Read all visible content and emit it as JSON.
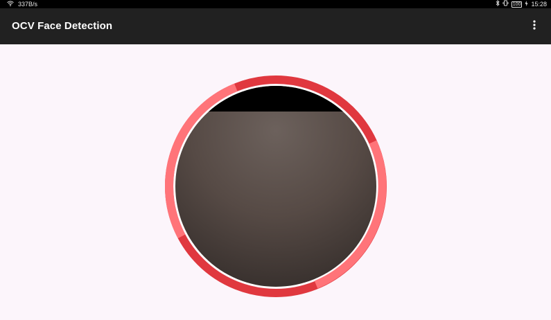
{
  "status_bar": {
    "network_speed": "337B/s",
    "battery_level": "100",
    "time": "15:28",
    "icons": [
      "wifi-icon",
      "bluetooth-icon",
      "vibrate-icon",
      "battery-icon",
      "charging-icon"
    ]
  },
  "app_bar": {
    "title": "OCV Face Detection",
    "overflow_icon": "more-vert-icon",
    "background_color": "#212121"
  },
  "camera_view": {
    "shape": "circle",
    "ring_colors": {
      "dark": "#e0383f",
      "light": "#ff7479"
    }
  }
}
